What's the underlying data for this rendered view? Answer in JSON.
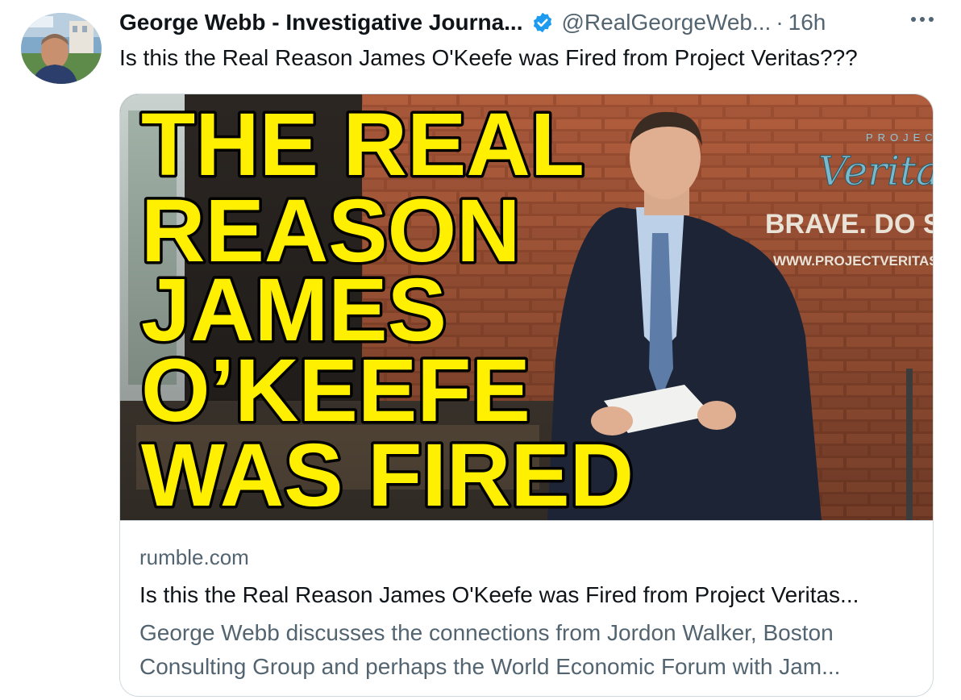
{
  "tweet": {
    "author_name": "George Webb - Investigative Journa...",
    "handle": "@RealGeorgeWeb...",
    "separator": "·",
    "time": "16h",
    "text": "Is this the Real Reason James O'Keefe was Fired from Project Veritas???"
  },
  "card": {
    "image_headline": [
      "THE REAL",
      "REASON",
      "JAMES",
      "O’KEEFE",
      "WAS FIRED"
    ],
    "sign_text": {
      "brand_small": "PROJEC",
      "brand_script": "Verita",
      "slogan": "BRAVE. DO SO",
      "url": "WWW.PROJECTVERITAS."
    },
    "domain": "rumble.com",
    "title": "Is this the Real Reason James O'Keefe was Fired from Project Veritas...",
    "description_line1": "George Webb discusses the connections from Jordon Walker, Boston",
    "description_line2": "Consulting Group and perhaps the World Economic Forum with Jam..."
  },
  "icons": {
    "verified": "verified-badge-icon",
    "more": "more-options-icon"
  },
  "colors": {
    "brand_blue": "#1d9bf0",
    "headline_yellow": "#ffef00",
    "secondary_text": "#536471",
    "border": "#cfd9de"
  }
}
